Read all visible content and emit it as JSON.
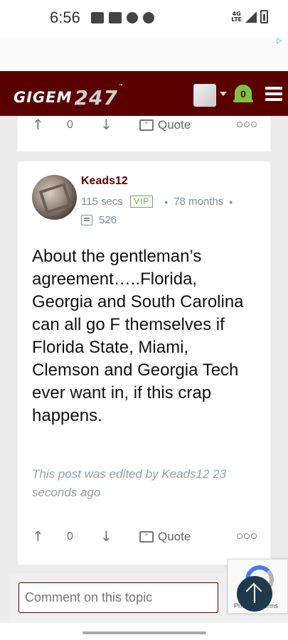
{
  "status_bar": {
    "time": "6:56",
    "network": "4G",
    "network_sub": "LTE",
    "icons": [
      "cast-icon",
      "image-icon",
      "heart-icon",
      "youtube-icon"
    ]
  },
  "header": {
    "logo_text": "GIGEM",
    "logo_num": "247",
    "logo_tm": "™",
    "notification_count": "0",
    "brand_color": "#5b0000",
    "bell_color": "#7cc242"
  },
  "prev_post": {
    "vote_count": "0",
    "quote_label": "Quote"
  },
  "post": {
    "username": "Keads12",
    "time": "115 secs",
    "badge": "VIP",
    "tenure": "78 months",
    "post_count": "526",
    "body": "About the gentleman’s agreement…..Florida, Georgia and South Carolina can all go F themselves if Florida State, Miami, Clemson and Georgia Tech ever want in, if this crap happens.",
    "edited_note": "This post was edited by Keads12 23 seconds ago",
    "vote_count": "0",
    "quote_label": "Quote"
  },
  "comment": {
    "placeholder": "Comment on this topic"
  },
  "recaptcha": {
    "terms": "Privacy - Terms"
  }
}
